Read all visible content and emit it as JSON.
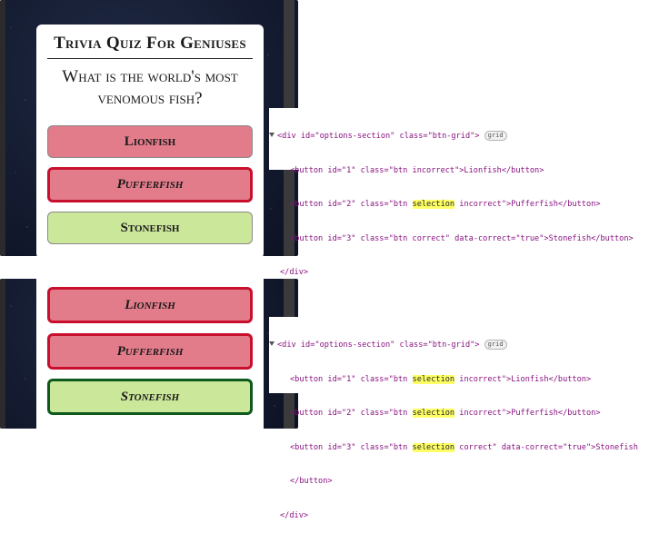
{
  "quiz": {
    "title": "Trivia Quiz For Geniuses",
    "question": "What is the world's most venomous fish?"
  },
  "before": {
    "options": [
      {
        "label": "Lionfish",
        "state": "incorrect"
      },
      {
        "label": "Pufferfish",
        "state": "selection incorrect"
      },
      {
        "label": "Stonefish",
        "state": "correct"
      }
    ]
  },
  "after": {
    "options": [
      {
        "label": "Lionfish",
        "state": "selection incorrect"
      },
      {
        "label": "Pufferfish",
        "state": "selection incorrect"
      },
      {
        "label": "Stonefish",
        "state": "selection correct"
      }
    ]
  },
  "devtools_top": {
    "div_open_pre": "<div id=\"options-section\" class=\"btn-grid\">",
    "badge": "grid",
    "line1": "<button id=\"1\" class=\"btn incorrect\">Lionfish</button>",
    "line2_pre": "<button id=\"2\" class=\"btn ",
    "line2_hl": "selection",
    "line2_post": " incorrect\">Pufferfish</button>",
    "line3": "<button id=\"3\" class=\"btn correct\" data-correct=\"true\">Stonefish</button>",
    "div_close": "</div>"
  },
  "devtools_bottom": {
    "div_open_pre": "<div id=\"options-section\" class=\"btn-grid\">",
    "badge": "grid",
    "line1_pre": "<button id=\"1\" class=\"btn ",
    "line1_hl": "selection",
    "line1_post": " incorrect\">Lionfish</button>",
    "line2_pre": "<button id=\"2\" class=\"btn ",
    "line2_hl": "selection",
    "line2_post": " incorrect\">Pufferfish</button>",
    "line3_pre": "<button id=\"3\" class=\"btn ",
    "line3_hl": "selection",
    "line3_post": " correct\" data-correct=\"true\">Stonefish",
    "line4": "</button>",
    "div_close": "</div>"
  },
  "colors": {
    "incorrect_bg": "#e27c8b",
    "correct_bg": "#cbe79a",
    "incorrect_border": "#c8102e",
    "correct_border": "#0d5a1c",
    "highlight": "#ffff66"
  }
}
